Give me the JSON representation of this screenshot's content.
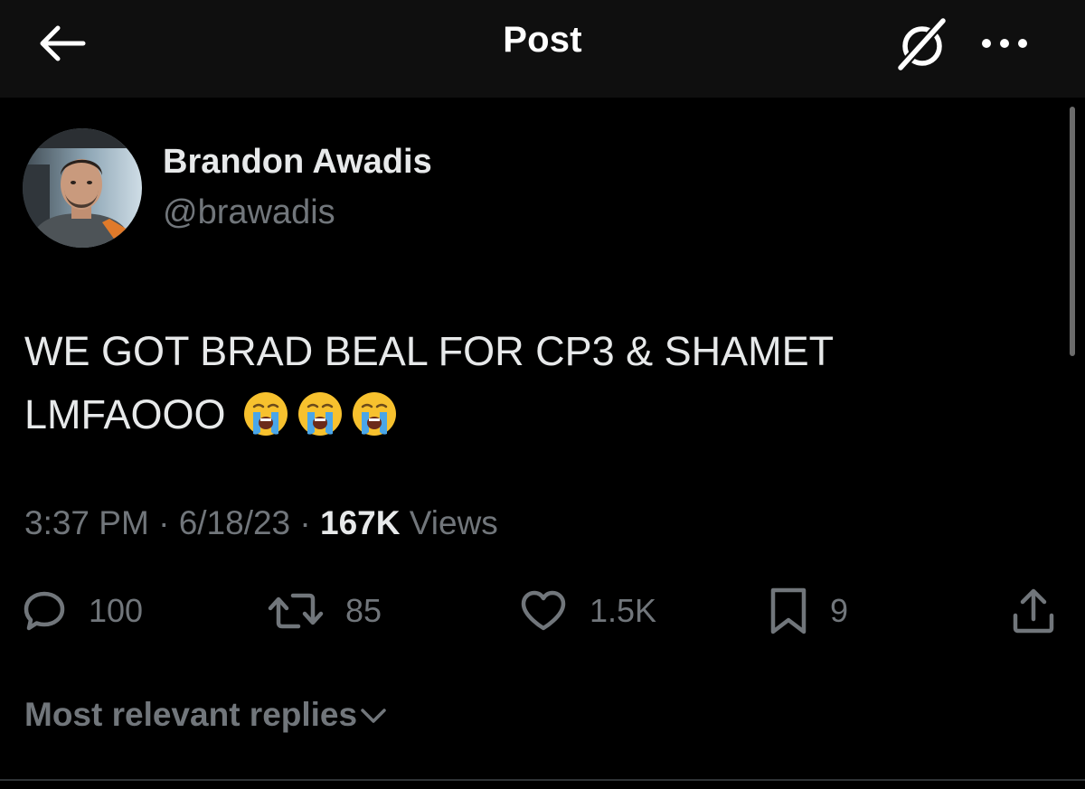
{
  "header": {
    "title": "Post",
    "back_icon": "arrow-left-icon",
    "grok_icon": "grok-slash-circle-icon",
    "more_icon": "more-horizontal-icon"
  },
  "author": {
    "display_name": "Brandon Awadis",
    "handle": "@brawadis"
  },
  "post": {
    "text_line1": "WE GOT BRAD BEAL FOR CP3 & SHAMET",
    "text_line2": "LMFAOOO",
    "emojis": [
      "loudly-crying-face",
      "loudly-crying-face",
      "loudly-crying-face"
    ]
  },
  "meta": {
    "time": "3:37 PM",
    "separator": "·",
    "date": "6/18/23",
    "views_count": "167K",
    "views_label": "Views"
  },
  "actions": {
    "replies": "100",
    "reposts": "85",
    "likes": "1.5K",
    "bookmarks": "9"
  },
  "replies_sort": {
    "label": "Most relevant replies"
  },
  "colors": {
    "background": "#000000",
    "header_bg": "#0f0f0f",
    "primary_text": "#e7e9ea",
    "secondary_text": "#71767b",
    "divider": "#2f3336",
    "emoji_yellow": "#f7c12e",
    "tear_blue": "#4aa6e8"
  }
}
